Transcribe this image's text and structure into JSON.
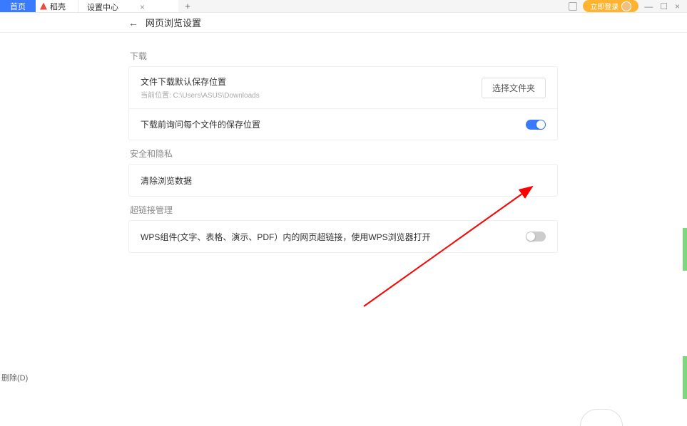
{
  "titlebar": {
    "tabs": {
      "home": "首页",
      "docs": "稻壳",
      "settings": "设置中心"
    },
    "login_label": "立即登录"
  },
  "header": {
    "page_title": "网页浏览设置"
  },
  "sections": {
    "download_label": "下载",
    "download": {
      "default_path_title": "文件下载默认保存位置",
      "default_path_sub": "当前位置: C:\\Users\\ASUS\\Downloads",
      "choose_folder_btn": "选择文件夹",
      "ask_each_time": "下载前询问每个文件的保存位置"
    },
    "privacy_label": "安全和隐私",
    "privacy": {
      "clear_data": "清除浏览数据"
    },
    "hyperlink_label": "超链接管理",
    "hyperlink": {
      "wps_open": "WPS组件(文字、表格、演示、PDF）内的网页超链接，使用WPS浏览器打开"
    }
  },
  "footer": {
    "delete_label": "删除(D)"
  }
}
